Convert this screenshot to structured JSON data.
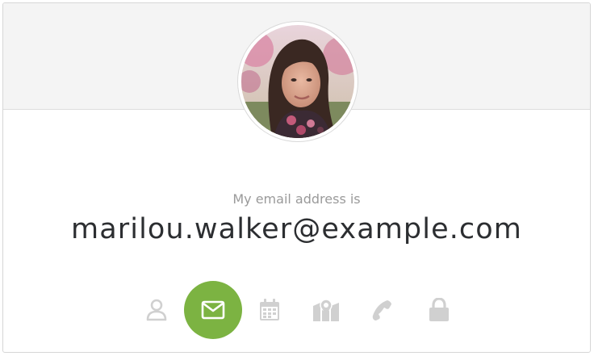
{
  "profile": {
    "avatar_alt": "profile photo",
    "label": "My email address is",
    "value": "marilou.walker@example.com"
  },
  "icons": [
    {
      "name": "person-icon",
      "active": false
    },
    {
      "name": "envelope-icon",
      "active": true
    },
    {
      "name": "calendar-icon",
      "active": false
    },
    {
      "name": "map-icon",
      "active": false
    },
    {
      "name": "phone-icon",
      "active": false
    },
    {
      "name": "lock-icon",
      "active": false
    }
  ],
  "colors": {
    "accent": "#7cb342",
    "icon_inactive": "#d0d0d0",
    "label": "#9a9a9a",
    "value": "#2c2e31",
    "header_bg": "#f4f4f4"
  }
}
